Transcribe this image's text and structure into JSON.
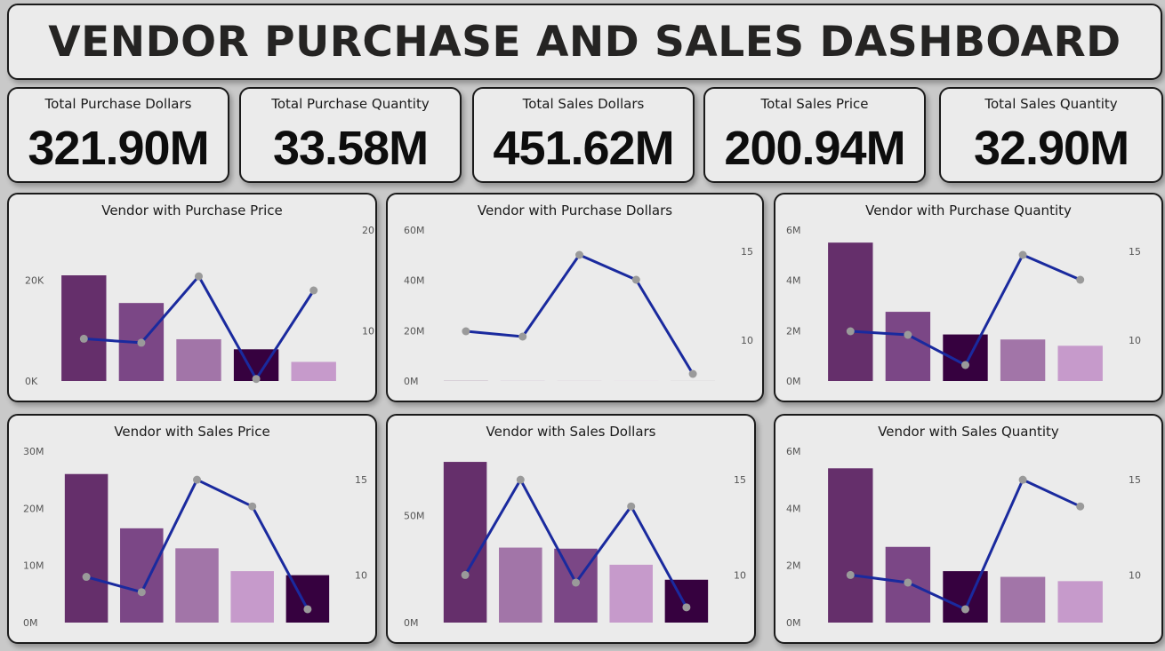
{
  "header": {
    "title": "VENDOR PURCHASE AND SALES DASHBOARD"
  },
  "kpis": [
    {
      "label": "Total Purchase Dollars",
      "value": "321.90M"
    },
    {
      "label": "Total Purchase Quantity",
      "value": "33.58M"
    },
    {
      "label": "Total Sales Dollars",
      "value": "451.62M"
    },
    {
      "label": "Total Sales Price",
      "value": "200.94M"
    },
    {
      "label": "Total Sales Quantity",
      "value": "32.90M"
    }
  ],
  "colors": {
    "line": "#1a2a9e",
    "marker": "#9a9a9a",
    "bar_palette": [
      "#652f6b",
      "#7b4786",
      "#a275a8",
      "#c69acb",
      "#36013f"
    ]
  },
  "chart_data": [
    {
      "type": "bar",
      "title": "Vendor with Purchase Price",
      "categories": [
        "",
        "",
        "",
        "",
        ""
      ],
      "values": [
        21000,
        15500,
        8300,
        6300,
        3800
      ],
      "bar_colors": [
        "#652f6b",
        "#7b4786",
        "#a275a8",
        "#36013f",
        "#c69acb"
      ],
      "ylim": [
        0,
        30000
      ],
      "yticks": [
        0,
        20000
      ],
      "ytick_labels": [
        "0K",
        "20K"
      ],
      "line": {
        "values": [
          9.2,
          8.8,
          15.4,
          5.2,
          14.0
        ],
        "ylim": [
          5,
          20
        ],
        "yticks": [
          10,
          20
        ],
        "ytick_labels": [
          "10",
          "20"
        ]
      }
    },
    {
      "type": "bar",
      "title": "Vendor with Purchase Dollars",
      "categories": [
        "",
        "",
        "",
        "",
        ""
      ],
      "values": [
        51000,
        24500,
        24300,
        17800,
        12300
      ],
      "bar_colors": [
        "#652f6b",
        "#7b4786",
        "#a275a8",
        "#c69acb",
        "#36013f"
      ],
      "ylim": [
        0,
        60000000
      ],
      "yticks": [
        0,
        20000000,
        40000000,
        60000000
      ],
      "ytick_labels": [
        "0M",
        "20M",
        "40M",
        "60M"
      ],
      "line": {
        "values": [
          10.5,
          10.2,
          14.8,
          13.4,
          8.1
        ],
        "ylim": [
          7.7,
          16.2
        ],
        "yticks": [
          10,
          15
        ],
        "ytick_labels": [
          "10",
          "15"
        ]
      }
    },
    {
      "type": "bar",
      "title": "Vendor with Purchase Quantity",
      "categories": [
        "",
        "",
        "",
        "",
        ""
      ],
      "values": [
        5500000,
        2750000,
        1850000,
        1650000,
        1400000
      ],
      "bar_colors": [
        "#652f6b",
        "#7b4786",
        "#36013f",
        "#a275a8",
        "#c69acb"
      ],
      "ylim": [
        0,
        6000000
      ],
      "yticks": [
        0,
        2000000,
        4000000,
        6000000
      ],
      "ytick_labels": [
        "0M",
        "2M",
        "4M",
        "6M"
      ],
      "line": {
        "values": [
          10.5,
          10.3,
          8.6,
          14.8,
          13.4
        ],
        "ylim": [
          7.7,
          16.2
        ],
        "yticks": [
          10,
          15
        ],
        "ytick_labels": [
          "10",
          "15"
        ]
      }
    },
    {
      "type": "bar",
      "title": "Vendor with Sales Price",
      "categories": [
        "",
        "",
        "",
        "",
        ""
      ],
      "values": [
        26000000,
        16500000,
        13000000,
        9000000,
        8300000
      ],
      "bar_colors": [
        "#652f6b",
        "#7b4786",
        "#a275a8",
        "#c69acb",
        "#36013f"
      ],
      "ylim": [
        0,
        30000000
      ],
      "yticks": [
        0,
        10000000,
        20000000,
        30000000
      ],
      "ytick_labels": [
        "0M",
        "10M",
        "20M",
        "30M"
      ],
      "line": {
        "values": [
          9.9,
          9.1,
          15.0,
          13.6,
          8.2
        ],
        "ylim": [
          7.5,
          16.5
        ],
        "yticks": [
          10,
          15
        ],
        "ytick_labels": [
          "10",
          "15"
        ]
      }
    },
    {
      "type": "bar",
      "title": "Vendor with Sales Dollars",
      "categories": [
        "",
        "",
        "",
        "",
        ""
      ],
      "values": [
        75000000,
        35000000,
        34500000,
        27000000,
        20000000
      ],
      "bar_colors": [
        "#652f6b",
        "#a275a8",
        "#7b4786",
        "#c69acb",
        "#36013f"
      ],
      "ylim": [
        0,
        80000000
      ],
      "yticks": [
        0,
        50000000
      ],
      "ytick_labels": [
        "0M",
        "50M"
      ],
      "line": {
        "values": [
          10.0,
          15.0,
          9.6,
          13.6,
          8.3
        ],
        "ylim": [
          7.5,
          16.5
        ],
        "yticks": [
          10,
          15
        ],
        "ytick_labels": [
          "10",
          "15"
        ]
      }
    },
    {
      "type": "bar",
      "title": "Vendor with Sales Quantity",
      "categories": [
        "",
        "",
        "",
        "",
        ""
      ],
      "values": [
        5400000,
        2650000,
        1800000,
        1600000,
        1450000
      ],
      "bar_colors": [
        "#652f6b",
        "#7b4786",
        "#36013f",
        "#a275a8",
        "#c69acb"
      ],
      "ylim": [
        0,
        6000000
      ],
      "yticks": [
        0,
        2000000,
        4000000,
        6000000
      ],
      "ytick_labels": [
        "0M",
        "2M",
        "4M",
        "6M"
      ],
      "line": {
        "values": [
          10.0,
          9.6,
          8.2,
          15.0,
          13.6
        ],
        "ylim": [
          7.5,
          16.5
        ],
        "yticks": [
          10,
          15
        ],
        "ytick_labels": [
          "10",
          "15"
        ]
      }
    }
  ]
}
